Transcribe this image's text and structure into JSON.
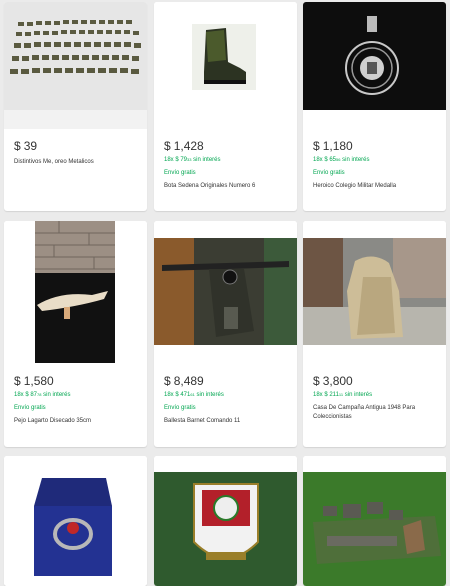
{
  "currency": "$",
  "installments_suffix": "sin interés",
  "free_shipping": "Envío gratis",
  "items": [
    {
      "price": "39",
      "installments": "",
      "inst_cents": "",
      "free_shipping": false,
      "title": "Distintivos Me, oreo Metalicos"
    },
    {
      "price": "1,428",
      "installments": "18x $ 79",
      "inst_cents": "33",
      "free_shipping": true,
      "title": "Bota Sedena Originales Numero 6"
    },
    {
      "price": "1,180",
      "installments": "18x $ 65",
      "inst_cents": "56",
      "free_shipping": true,
      "title": "Heroico Colegio Militar Medalla"
    },
    {
      "price": "1,580",
      "installments": "18x $ 87",
      "inst_cents": "78",
      "free_shipping": true,
      "title": "Pejo Lagarto Disecado 35cm"
    },
    {
      "price": "8,489",
      "installments": "18x $ 471",
      "inst_cents": "61",
      "free_shipping": true,
      "title": "Ballesta Barnet Comando 11"
    },
    {
      "price": "3,800",
      "installments": "18x $ 211",
      "inst_cents": "11",
      "free_shipping": false,
      "title": "Casa De Campaña Antigua 1948 Para Coleccionistas"
    }
  ]
}
